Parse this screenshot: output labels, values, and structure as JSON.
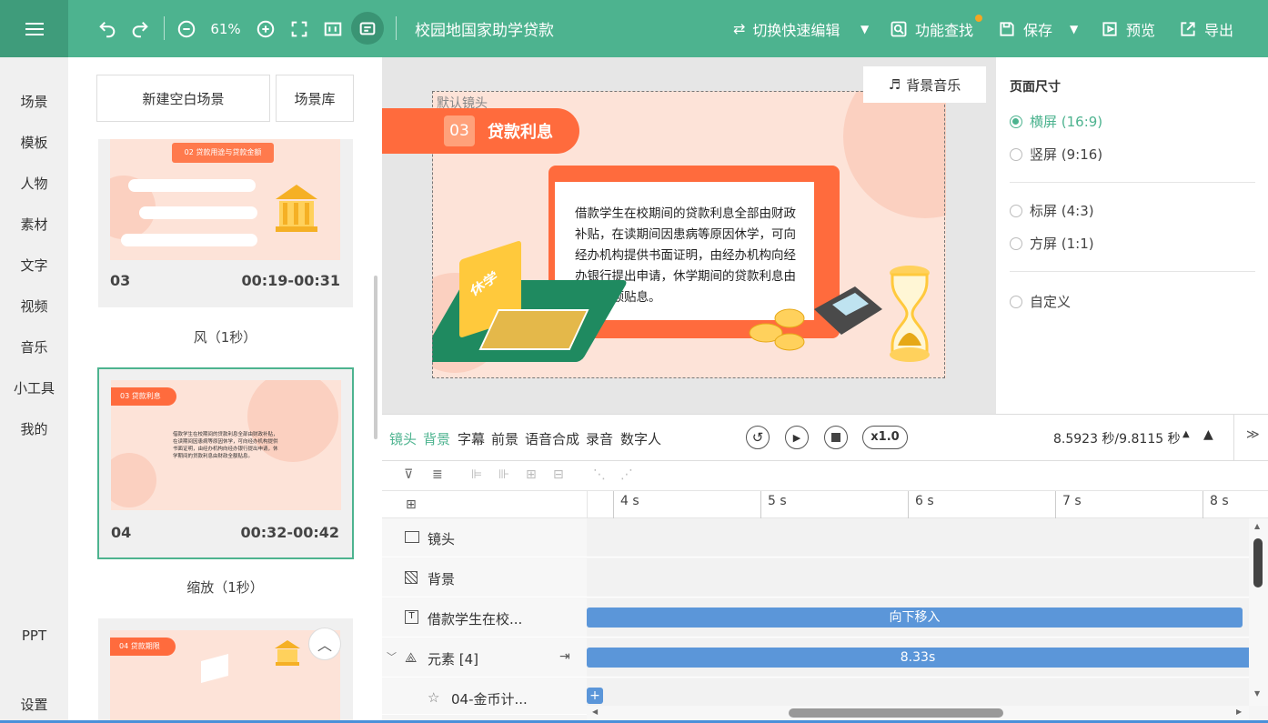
{
  "toolbar": {
    "zoom": "61%",
    "title": "校园地国家助学贷款",
    "switch_edit": "切换快速编辑",
    "feature_search": "功能查找",
    "save": "保存",
    "preview": "预览",
    "export": "导出"
  },
  "sidebar": {
    "items": [
      "场景",
      "模板",
      "人物",
      "素材",
      "文字",
      "视频",
      "音乐",
      "小工具",
      "我的",
      "PPT",
      "设置"
    ]
  },
  "scenes": {
    "new_blank": "新建空白场景",
    "library": "场景库",
    "cards": [
      {
        "num": "03",
        "time": "00:19-00:31",
        "thumb_title": "02 贷款用途与贷款金额"
      },
      {
        "num": "04",
        "time": "00:32-00:42",
        "thumb_title": "03 贷款利息"
      },
      {
        "num": "",
        "time": "",
        "thumb_title": "04 贷款期限"
      }
    ],
    "transitions": [
      "风（1秒）",
      "缩放（1秒）"
    ]
  },
  "canvas": {
    "bg_music": "背景音乐",
    "default_camera": "默认镜头",
    "badge_num": "03",
    "badge_text": "贷款利息",
    "paragraph": "借款学生在校期间的贷款利息全部由财政补贴，在读期间因患病等原因休学，可向经办机构提供书面证明，由经办机构向经办银行提出申请，休学期间的贷款利息由财政全额贴息。",
    "sign_text": "休学"
  },
  "props": {
    "title": "页面尺寸",
    "options": [
      "横屏 (16:9)",
      "竖屏 (9:16)",
      "标屏 (4:3)",
      "方屏 (1:1)",
      "自定义"
    ],
    "selected": 0
  },
  "timeline": {
    "tabs": [
      "镜头",
      "背景",
      "字幕",
      "前景",
      "语音合成",
      "录音",
      "数字人"
    ],
    "active_tabs": [
      0,
      1
    ],
    "speed": "x1.0",
    "time": "8.5923 秒/9.8115 秒",
    "ticks": [
      "4 s",
      "5 s",
      "6 s",
      "7 s",
      "8 s"
    ],
    "tracks": [
      "镜头",
      "背景",
      "借款学生在校...",
      "元素 [4]",
      "04-金币计..."
    ],
    "clips": {
      "text_anim": "向下移入",
      "element_dur": "8.33s"
    }
  },
  "colors": {
    "brand": "#4db38f",
    "accent": "#ff6b3d",
    "clip": "#5b96d9"
  }
}
